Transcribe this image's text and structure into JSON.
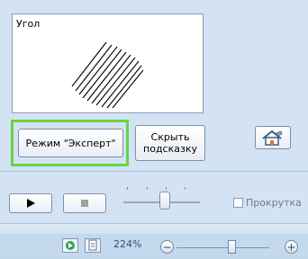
{
  "preview": {
    "label": "Угол"
  },
  "buttons": {
    "expert_label": "Режим \"Эксперт\"",
    "hint_label_line1": "Скрыть",
    "hint_label_line2": "подсказку"
  },
  "playback": {
    "scroll_label": "Прокрутка",
    "scroll_checked": false
  },
  "statusbar": {
    "zoom": "224%"
  },
  "icons": {
    "home": "home-settings-icon",
    "play": "play-icon",
    "stop": "stop-icon",
    "zoom_out": "minus-icon",
    "zoom_in": "plus-icon"
  },
  "colors": {
    "highlight": "#6ad245",
    "panel": "#d3e3f4"
  }
}
